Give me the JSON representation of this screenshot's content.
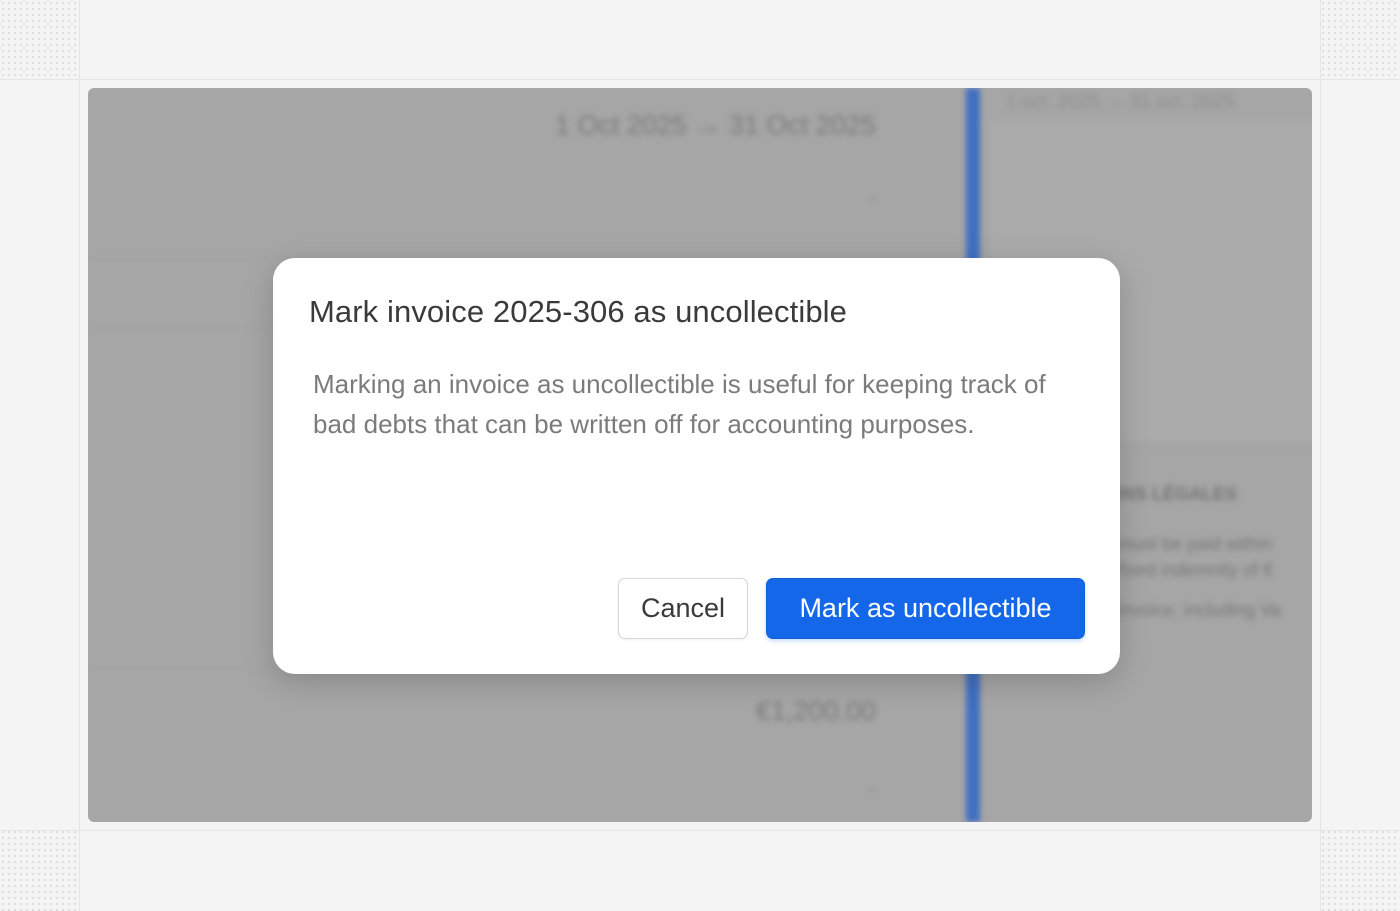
{
  "background": {
    "period": "1 Oct 2025 → 31 Oct 2025",
    "dash_top": "-",
    "amount": "€1,200.00",
    "dash_bottom": "-",
    "right_period": "1 oct. 2025 → 31 oct. 2025",
    "legal_heading": "ONS LÉGALES",
    "legal_line_1": "must be paid within",
    "legal_line_2": "fixed indemnity of €",
    "legal_line_3": "invoice, including Va"
  },
  "modal": {
    "title": "Mark invoice 2025-306 as uncollectible",
    "body": "Marking an invoice as uncollectible is useful for keeping track of bad debts that can be written off for accounting purposes.",
    "cancel_label": "Cancel",
    "confirm_label": "Mark as uncollectible"
  },
  "colors": {
    "primary": "#1467e8",
    "overlay": "#a6a6a6",
    "accent_bar": "#3f6fc2"
  }
}
